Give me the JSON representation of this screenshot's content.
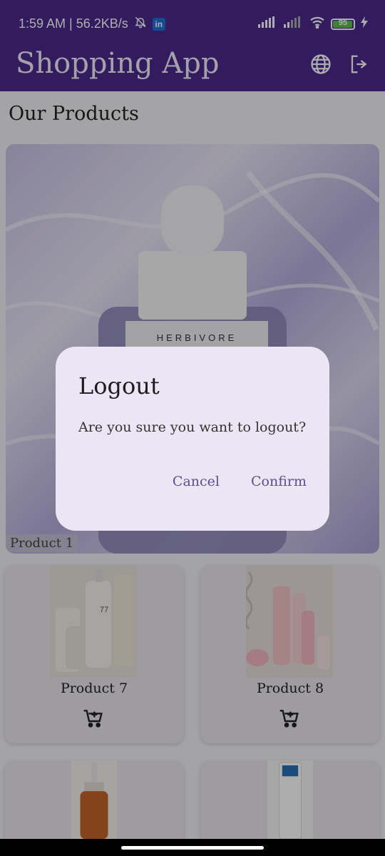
{
  "status_bar": {
    "time_speed": "1:59 AM | 56.2KB/s",
    "linkedin_badge": "in",
    "battery": "95",
    "battery_level": 0.95
  },
  "app_bar": {
    "title": "Shopping App",
    "actions": [
      "globe-icon",
      "logout-icon"
    ]
  },
  "section_title": "Our Products",
  "hero": {
    "brand_text": "HERBIVORE",
    "label": "Product 1"
  },
  "products": [
    {
      "name": "Product 7",
      "icon": "add-to-cart-icon"
    },
    {
      "name": "Product 8",
      "icon": "add-to-cart-icon"
    }
  ],
  "dialog": {
    "title": "Logout",
    "message": "Are you sure you want to logout?",
    "cancel_label": "Cancel",
    "confirm_label": "Confirm"
  },
  "colors": {
    "primary": "#4a2a8c",
    "dialog_bg": "#ece5f3",
    "dialog_button": "#5c4d97"
  }
}
